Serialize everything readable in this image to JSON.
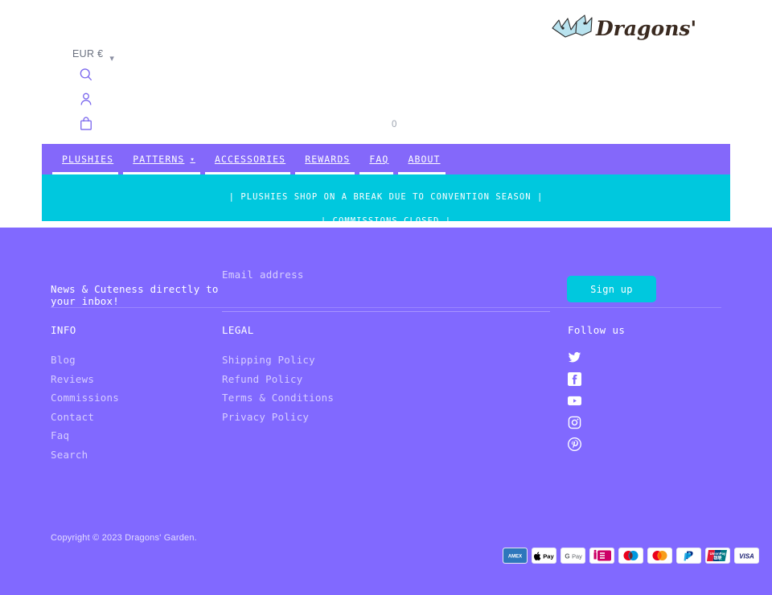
{
  "brand": {
    "name": "Dragons' Garden",
    "logo_icon": "dragon-logo"
  },
  "header": {
    "currency": {
      "label": "EUR €",
      "chevron": "chevron-down-icon"
    },
    "icons": [
      {
        "name": "search-icon"
      },
      {
        "name": "account-icon"
      },
      {
        "name": "cart-icon"
      }
    ],
    "cart_count": "0"
  },
  "nav": {
    "items": [
      {
        "label": "PLUSHIES",
        "has_dropdown": false
      },
      {
        "label": "PATTERNS",
        "has_dropdown": true,
        "chevron": "chevron-down-icon"
      },
      {
        "label": "ACCESSORIES",
        "has_dropdown": false
      },
      {
        "label": "REWARDS",
        "has_dropdown": false
      },
      {
        "label": "FAQ",
        "has_dropdown": false
      },
      {
        "label": "ABOUT",
        "has_dropdown": false
      }
    ]
  },
  "announcement": {
    "lines": [
      "| PLUSHIES SHOP ON A BREAK DUE TO CONVENTION SEASON |",
      "| COMMISSIONS CLOSED |"
    ]
  },
  "newsletter": {
    "heading": "News & Cuteness directly to your inbox!",
    "email_label": "Email address",
    "email_value": "",
    "email_placeholder": "",
    "signup_label": "Sign up"
  },
  "footer": {
    "info": {
      "title": "INFO",
      "links": [
        "Blog",
        "Reviews",
        "Commissions",
        "Contact",
        "Faq",
        "Search"
      ]
    },
    "legal": {
      "title": "LEGAL",
      "links": [
        "Shipping Policy",
        "Refund Policy",
        "Terms & Conditions",
        "Privacy Policy"
      ]
    },
    "follow": {
      "title": "Follow us",
      "socials": [
        {
          "name": "twitter-icon"
        },
        {
          "name": "facebook-icon"
        },
        {
          "name": "youtube-icon"
        },
        {
          "name": "instagram-icon"
        },
        {
          "name": "pinterest-icon"
        }
      ]
    },
    "copyright": "Copyright © 2023 Dragons' Garden.",
    "payments": [
      {
        "name": "amex-icon",
        "label": "AMEX"
      },
      {
        "name": "apple-pay-icon",
        "label": "Pay"
      },
      {
        "name": "google-pay-icon",
        "label": "G Pay"
      },
      {
        "name": "ideal-icon",
        "label": "iDEAL"
      },
      {
        "name": "maestro-icon",
        "label": "Maestro"
      },
      {
        "name": "mastercard-icon",
        "label": "Mastercard"
      },
      {
        "name": "paypal-icon",
        "label": "PayPal"
      },
      {
        "name": "unionpay-icon",
        "label": "UnionPay"
      },
      {
        "name": "visa-icon",
        "label": "VISA"
      }
    ]
  },
  "colors": {
    "nav_purple": "#8468fa",
    "footer_purple": "#8169ff",
    "cyan": "#00c8de",
    "icon_purple": "#7b68ee",
    "white": "#ffffff"
  }
}
